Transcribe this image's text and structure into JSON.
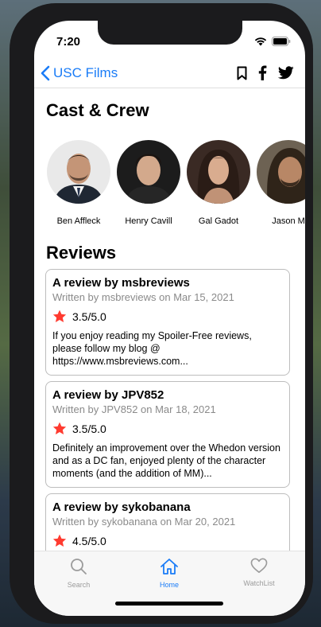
{
  "status_bar": {
    "time": "7:20"
  },
  "nav": {
    "back_label": "USC Films"
  },
  "cast": {
    "title": "Cast & Crew",
    "members": [
      {
        "name": "Ben Affleck"
      },
      {
        "name": "Henry Cavill"
      },
      {
        "name": "Gal Gadot"
      },
      {
        "name": "Jason M"
      }
    ]
  },
  "reviews": {
    "title": "Reviews",
    "items": [
      {
        "title": "A review by msbreviews",
        "subtitle": "Written by msbreviews on Mar 15, 2021",
        "rating": "3.5/5.0",
        "body": "If you enjoy reading my Spoiler-Free reviews, please follow my blog @ https://www.msbreviews.com..."
      },
      {
        "title": "A review by JPV852",
        "subtitle": "Written by JPV852 on Mar 18, 2021",
        "rating": "3.5/5.0",
        "body": "Definitely an improvement over the Whedon version and as a DC fan, enjoyed plenty of the character moments (and the addition of MM)..."
      },
      {
        "title": "A review by sykobanana",
        "subtitle": "Written by sykobanana on Mar 20, 2021",
        "rating": "4.5/5.0",
        "body": ""
      }
    ]
  },
  "tabbar": {
    "tabs": [
      {
        "label": "Search",
        "icon": "magnifier-icon"
      },
      {
        "label": "Home",
        "icon": "house-icon",
        "active": true
      },
      {
        "label": "WatchList",
        "icon": "heart-icon"
      }
    ]
  },
  "colors": {
    "accent": "#1a7cf7",
    "star": "#ff3b30",
    "inactive": "#9b9b9b"
  }
}
